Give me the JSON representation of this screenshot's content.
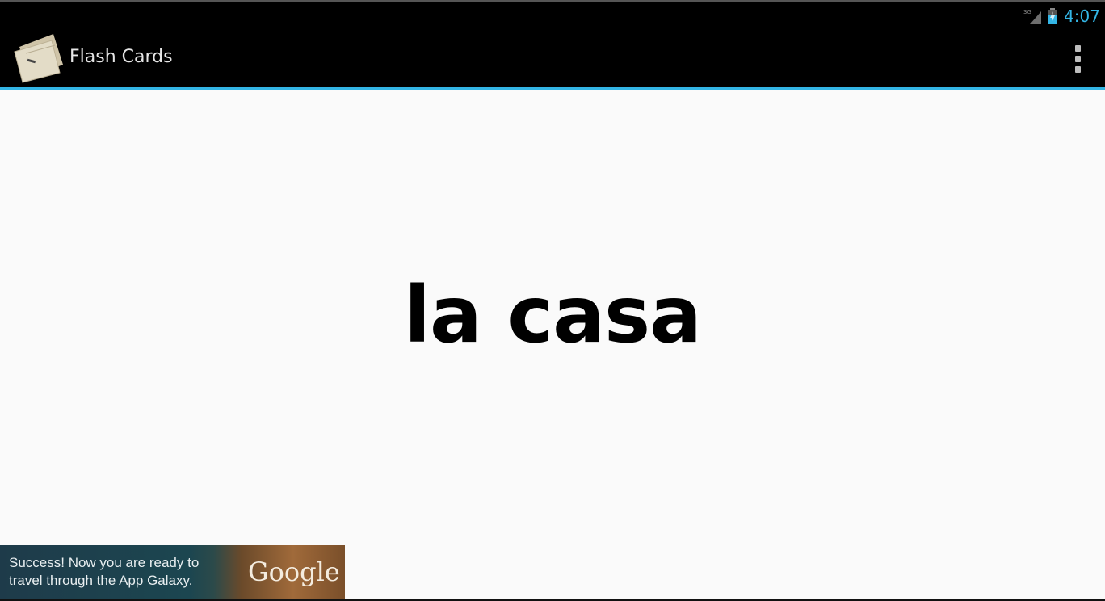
{
  "status_bar": {
    "network_label": "3G",
    "time": "4:07",
    "accent_color": "#33b5e5"
  },
  "action_bar": {
    "title": "Flash Cards",
    "app_icon": "flash-cards-icon",
    "overflow_icon": "overflow-menu-icon"
  },
  "card": {
    "word": "la casa"
  },
  "ad_banner": {
    "line1": "Success! Now you are ready to",
    "line2": "travel through the App Galaxy.",
    "brand": "Google"
  }
}
